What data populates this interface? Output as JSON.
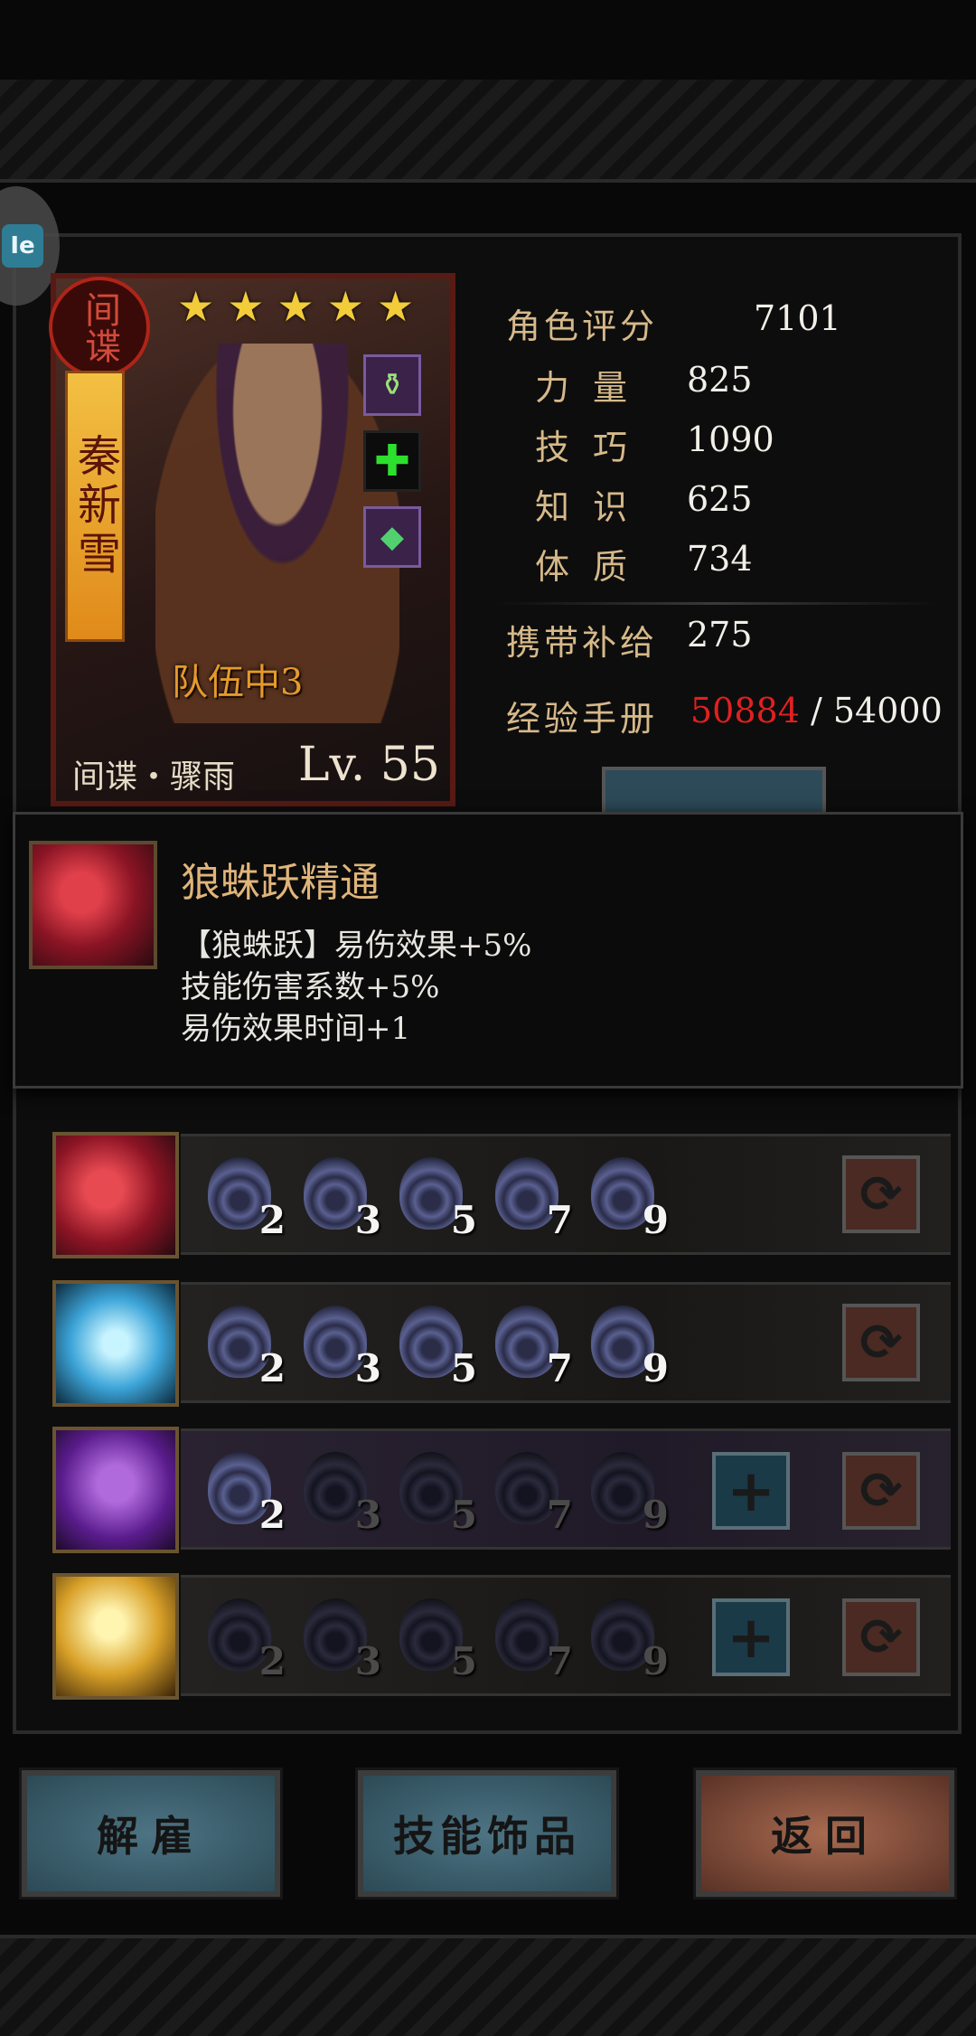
{
  "character": {
    "class_badge": "间谍",
    "name": "秦新雪",
    "stars": [
      "★",
      "★",
      "★",
      "★",
      "★"
    ],
    "party_label": "队伍中3",
    "subclass": "间谍・骤雨",
    "level": "Lv. 55",
    "equipment_icons": [
      "potion-icon",
      "heal-cross-icon",
      "green-gem-icon"
    ]
  },
  "stats": {
    "rating_label": "角色评分",
    "rating_value": "7101",
    "strength_label": "力量",
    "strength_value": "825",
    "skill_label": "技巧",
    "skill_value": "1090",
    "knowledge_label": "知识",
    "knowledge_value": "625",
    "constitution_label": "体质",
    "constitution_value": "734",
    "supply_label": "携带补给",
    "supply_value": "275",
    "exp_label": "经验手册",
    "exp_current": "50884",
    "exp_max": "/ 54000"
  },
  "tooltip": {
    "title": "狼蛛跃精通",
    "lines": [
      "【狼蛛跃】易伤效果+5%",
      "技能伤害系数+5%",
      "易伤效果时间+1"
    ]
  },
  "skill_rows": [
    {
      "icon": "wolf-spider-leap-icon",
      "levels": [
        "2",
        "3",
        "5",
        "7",
        "9"
      ],
      "unlocked": 5
    },
    {
      "icon": "blade-slash-icon",
      "levels": [
        "2",
        "3",
        "5",
        "7",
        "9"
      ],
      "unlocked": 5
    },
    {
      "icon": "high-kick-icon",
      "levels": [
        "2",
        "3",
        "5",
        "7",
        "9"
      ],
      "unlocked": 1
    },
    {
      "icon": "burst-strike-icon",
      "levels": [
        "2",
        "3",
        "5",
        "7",
        "9"
      ],
      "unlocked": 0
    }
  ],
  "buttons": {
    "dismiss": "解雇",
    "skill_trinkets": "技能饰品",
    "back": "返回"
  },
  "colors": {
    "exp_current": "#e12020",
    "accent_gold": "#d6b98a",
    "button_teal": "#2c4a56",
    "button_rust": "#5a3226"
  }
}
